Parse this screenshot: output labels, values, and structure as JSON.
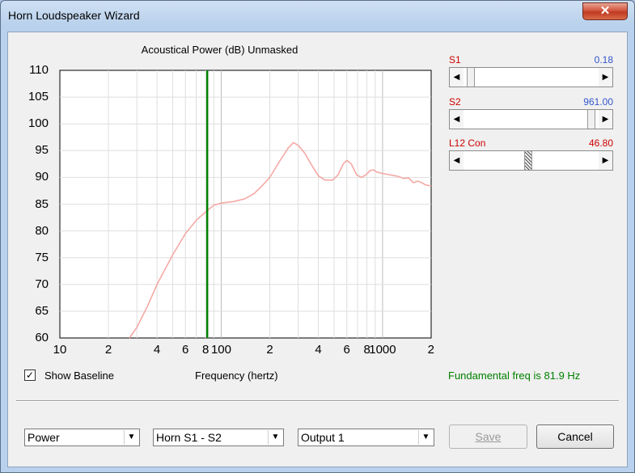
{
  "window": {
    "title": "Horn Loudspeaker Wizard",
    "close_glyph": "✕"
  },
  "chart_data": {
    "type": "line",
    "title": "Acoustical Power (dB)   Unmasked",
    "xlabel": "Frequency (hertz)",
    "ylabel": "",
    "xscale": "log",
    "xlim": [
      10,
      2000
    ],
    "ylim": [
      60,
      110
    ],
    "yticks": [
      60,
      65,
      70,
      75,
      80,
      85,
      90,
      95,
      100,
      105,
      110
    ],
    "xtick_labels": [
      {
        "x": 10,
        "label": "10"
      },
      {
        "x": 20,
        "label": "2"
      },
      {
        "x": 40,
        "label": "4"
      },
      {
        "x": 60,
        "label": "6"
      },
      {
        "x": 80,
        "label": "8"
      },
      {
        "x": 100,
        "label": "100"
      },
      {
        "x": 200,
        "label": "2"
      },
      {
        "x": 400,
        "label": "4"
      },
      {
        "x": 600,
        "label": "6"
      },
      {
        "x": 800,
        "label": "8"
      },
      {
        "x": 1000,
        "label": "1000"
      },
      {
        "x": 2000,
        "label": "2"
      }
    ],
    "grid": true,
    "marker_line": {
      "x": 81.9,
      "color": "#008000"
    },
    "series": [
      {
        "color": "#f4a9a4",
        "points": [
          [
            27,
            60
          ],
          [
            30,
            62
          ],
          [
            35,
            66
          ],
          [
            40,
            70
          ],
          [
            50,
            75.5
          ],
          [
            60,
            79.5
          ],
          [
            70,
            82
          ],
          [
            81.9,
            83.8
          ],
          [
            90,
            84.8
          ],
          [
            100,
            85.2
          ],
          [
            120,
            85.5
          ],
          [
            140,
            86
          ],
          [
            160,
            87
          ],
          [
            180,
            88.5
          ],
          [
            200,
            90
          ],
          [
            230,
            93
          ],
          [
            260,
            95.5
          ],
          [
            280,
            96.5
          ],
          [
            300,
            96
          ],
          [
            330,
            94.5
          ],
          [
            360,
            92.5
          ],
          [
            400,
            90.3
          ],
          [
            440,
            89.5
          ],
          [
            490,
            89.5
          ],
          [
            530,
            90.5
          ],
          [
            570,
            92.5
          ],
          [
            600,
            93.2
          ],
          [
            640,
            92.5
          ],
          [
            690,
            90.5
          ],
          [
            740,
            90
          ],
          [
            790,
            90.5
          ],
          [
            840,
            91.3
          ],
          [
            880,
            91.4
          ],
          [
            920,
            91
          ],
          [
            980,
            90.8
          ],
          [
            1050,
            90.6
          ],
          [
            1150,
            90.4
          ],
          [
            1250,
            90.2
          ],
          [
            1350,
            89.8
          ],
          [
            1450,
            89.9
          ],
          [
            1550,
            89
          ],
          [
            1650,
            89.3
          ],
          [
            1750,
            89
          ],
          [
            1850,
            88.6
          ],
          [
            2000,
            88.4
          ]
        ]
      }
    ]
  },
  "baseline": {
    "checkbox_label": "Show Baseline",
    "checked_glyph": "✓"
  },
  "fundamental": {
    "text": "Fundamental freq is 81.9 Hz",
    "color": "#008000"
  },
  "sliders": [
    {
      "label": "S1",
      "value_text": "0.18",
      "label_color": "#cc0000",
      "value_color": "#3355cc",
      "position": 0.02
    },
    {
      "label": "S2",
      "value_text": "961.00",
      "label_color": "#cc0000",
      "value_color": "#3355cc",
      "position": 0.98
    },
    {
      "label": "L12  Con",
      "value_text": "46.80",
      "label_color": "#cc0000",
      "value_color": "#cc0000",
      "position": 0.48
    }
  ],
  "controls": {
    "power_select": "Power",
    "horn_select": "Horn S1 - S2",
    "output_select": "Output 1",
    "save_label": "Save",
    "cancel_label": "Cancel",
    "dropdown_glyph": "▼",
    "left_arrow": "◀",
    "right_arrow": "▶"
  }
}
